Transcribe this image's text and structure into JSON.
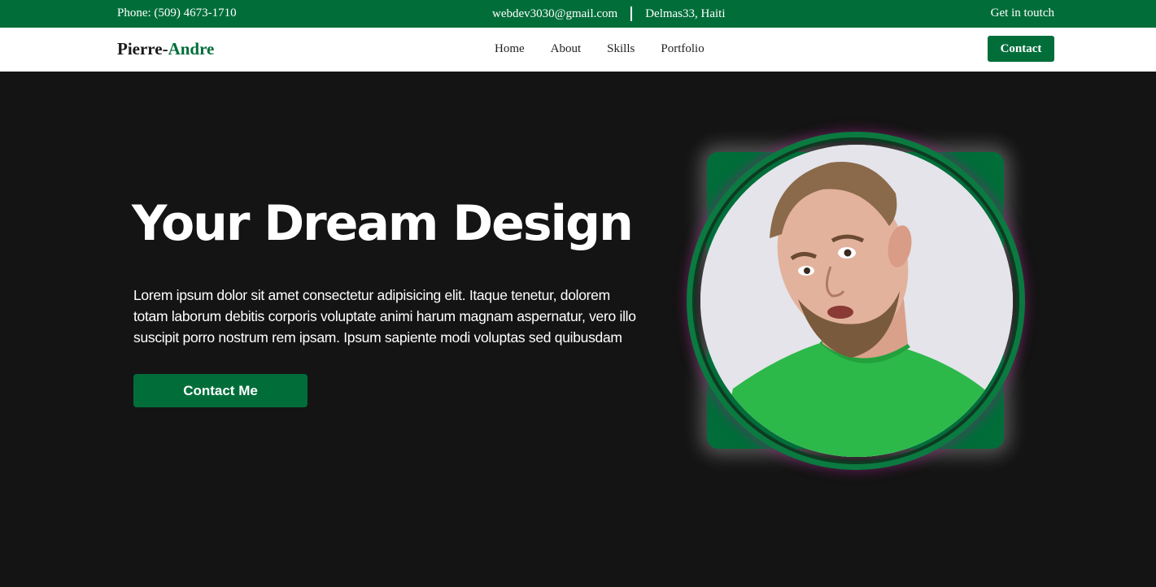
{
  "topbar": {
    "phone": "Phone: (509) 4673-1710",
    "email": "webdev3030@gmail.com",
    "location": "Delmas33, Haiti",
    "cta": "Get in toutch"
  },
  "navbar": {
    "logo_first": "Pierre",
    "logo_dash": "-",
    "logo_second": "Andre",
    "links": [
      "Home",
      "About",
      "Skills",
      "Portfolio"
    ],
    "contact_button": "Contact"
  },
  "hero": {
    "title": "Your Dream Design",
    "text": "Lorem ipsum dolor sit amet consectetur adipisicing elit. Itaque tenetur, dolorem totam laborum debitis corporis voluptate animi harum magnam aspernatur, vero illo suscipit porro nostrum rem ipsam. Ipsum sapiente modi voluptas sed quibusdam",
    "button": "Contact Me",
    "image_subject": "portrait-photo"
  },
  "colors": {
    "brand_green": "#016e3a",
    "hero_background": "#141414",
    "shirt_green": "#2db84a"
  }
}
